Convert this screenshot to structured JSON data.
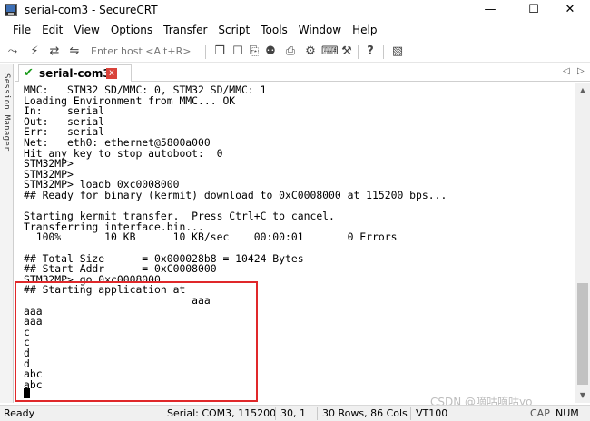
{
  "window": {
    "title": "serial-com3 - SecureCRT",
    "minimize_glyph": "—",
    "maximize_glyph": "☐",
    "close_glyph": "✕"
  },
  "menu": [
    "File",
    "Edit",
    "View",
    "Options",
    "Transfer",
    "Script",
    "Tools",
    "Window",
    "Help"
  ],
  "toolbar": {
    "host_placeholder": "Enter host <Alt+R>",
    "icons_left": [
      "connect-icon",
      "lightning-icon",
      "reconnect-icon",
      "disconnect-icon"
    ],
    "icons_right": [
      "copy-icon",
      "paste-icon",
      "clipboard-icon",
      "find-icon",
      "print-icon",
      "settings-icon",
      "keymap-icon",
      "tool-icon",
      "help-icon",
      "sftp-icon"
    ]
  },
  "sidebar": {
    "label": "Session Manager"
  },
  "tab": {
    "label": "serial-com3",
    "close_glyph": "x",
    "left_arrow": "◁",
    "right_arrow": "▷"
  },
  "terminal": {
    "lines": [
      "MMC:   STM32 SD/MMC: 0, STM32 SD/MMC: 1",
      "Loading Environment from MMC... OK",
      "In:    serial",
      "Out:   serial",
      "Err:   serial",
      "Net:   eth0: ethernet@5800a000",
      "Hit any key to stop autoboot:  0",
      "STM32MP>",
      "STM32MP>",
      "STM32MP> loadb 0xc0008000",
      "## Ready for binary (kermit) download to 0xC0008000 at 115200 bps...",
      "",
      "Starting kermit transfer.  Press Ctrl+C to cancel.",
      "Transferring interface.bin...",
      "  100%       10 KB      10 KB/sec    00:00:01       0 Errors",
      "",
      "## Total Size      = 0x000028b8 = 10424 Bytes",
      "## Start Addr      = 0xC0008000",
      "STM32MP> go 0xc0008000",
      "## Starting application at",
      "                           aaa",
      "aaa",
      "aaa",
      "c",
      "c",
      "d",
      "d",
      "abc",
      "abc"
    ]
  },
  "statusbar": {
    "ready": "Ready",
    "serial": "Serial: COM3, 115200",
    "position": "30,  1",
    "size": "30 Rows, 86 Cols",
    "terminal_type": "VT100",
    "cap": "CAP",
    "num": "NUM",
    "watermark": "CSDN @嘀咕嘀咕yo"
  },
  "colors": {
    "highlight_border": "#e0282a",
    "tab_check": "#1a9b1a",
    "tab_close": "#d9423a"
  }
}
